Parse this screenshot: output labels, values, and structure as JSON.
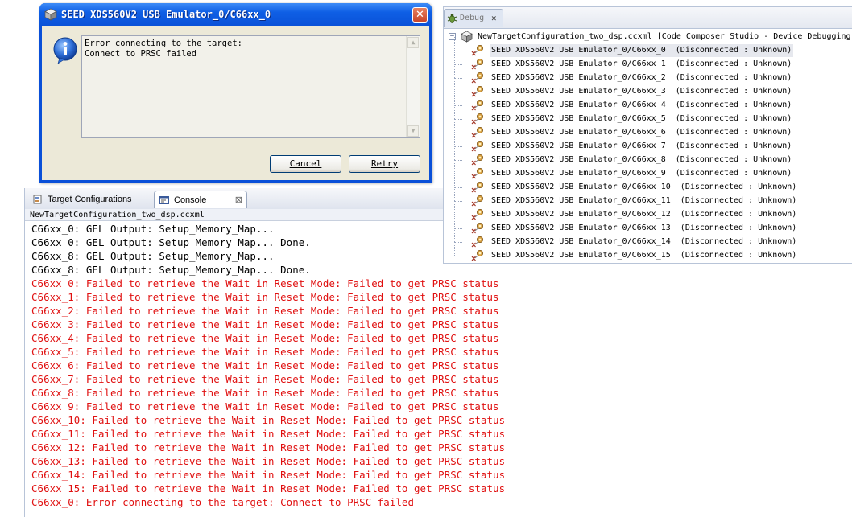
{
  "dialog": {
    "title": "SEED XDS560V2 USB Emulator_0/C66xx_0",
    "close_glyph": "✕",
    "message": "Error connecting to the target:\nConnect to PRSC failed",
    "cancel_label": "Cancel",
    "retry_label": "Retry",
    "icon": "info-icon"
  },
  "console_panel": {
    "tabs": [
      {
        "label": "Target Configurations",
        "icon": "target-config-icon"
      },
      {
        "label": "Console",
        "icon": "console-icon",
        "close": "⊠"
      }
    ],
    "path": "NewTargetConfiguration_two_dsp.ccxml",
    "lines": [
      {
        "text": "C66xx_0: GEL Output: Setup_Memory_Map...",
        "kind": "normal"
      },
      {
        "text": "C66xx_0: GEL Output: Setup_Memory_Map... Done.",
        "kind": "normal"
      },
      {
        "text": "C66xx_8: GEL Output: Setup_Memory_Map...",
        "kind": "normal"
      },
      {
        "text": "C66xx_8: GEL Output: Setup_Memory_Map... Done.",
        "kind": "normal"
      },
      {
        "text": "C66xx_0: Failed to retrieve the Wait in Reset Mode: Failed to get PRSC status",
        "kind": "error"
      },
      {
        "text": "C66xx_1: Failed to retrieve the Wait in Reset Mode: Failed to get PRSC status",
        "kind": "error"
      },
      {
        "text": "C66xx_2: Failed to retrieve the Wait in Reset Mode: Failed to get PRSC status",
        "kind": "error"
      },
      {
        "text": "C66xx_3: Failed to retrieve the Wait in Reset Mode: Failed to get PRSC status",
        "kind": "error"
      },
      {
        "text": "C66xx_4: Failed to retrieve the Wait in Reset Mode: Failed to get PRSC status",
        "kind": "error"
      },
      {
        "text": "C66xx_5: Failed to retrieve the Wait in Reset Mode: Failed to get PRSC status",
        "kind": "error"
      },
      {
        "text": "C66xx_6: Failed to retrieve the Wait in Reset Mode: Failed to get PRSC status",
        "kind": "error"
      },
      {
        "text": "C66xx_7: Failed to retrieve the Wait in Reset Mode: Failed to get PRSC status",
        "kind": "error"
      },
      {
        "text": "C66xx_8: Failed to retrieve the Wait in Reset Mode: Failed to get PRSC status",
        "kind": "error"
      },
      {
        "text": "C66xx_9: Failed to retrieve the Wait in Reset Mode: Failed to get PRSC status",
        "kind": "error"
      },
      {
        "text": "C66xx_10: Failed to retrieve the Wait in Reset Mode: Failed to get PRSC status",
        "kind": "error"
      },
      {
        "text": "C66xx_11: Failed to retrieve the Wait in Reset Mode: Failed to get PRSC status",
        "kind": "error"
      },
      {
        "text": "C66xx_12: Failed to retrieve the Wait in Reset Mode: Failed to get PRSC status",
        "kind": "error"
      },
      {
        "text": "C66xx_13: Failed to retrieve the Wait in Reset Mode: Failed to get PRSC status",
        "kind": "error"
      },
      {
        "text": "C66xx_14: Failed to retrieve the Wait in Reset Mode: Failed to get PRSC status",
        "kind": "error"
      },
      {
        "text": "C66xx_15: Failed to retrieve the Wait in Reset Mode: Failed to get PRSC status",
        "kind": "error"
      },
      {
        "text": "C66xx_0: Error connecting to the target: Connect to PRSC failed",
        "kind": "error"
      }
    ],
    "colors": {
      "normal": "#000000",
      "error": "#e01010"
    }
  },
  "debug_panel": {
    "tab_label": "Debug",
    "tab_icon": "debug-bug-icon",
    "tab_close": "✕",
    "root": {
      "toggle": "−",
      "label": "NewTargetConfiguration_two_dsp.ccxml [Code Composer Studio - Device Debugging]",
      "icon": "target-cube-icon"
    },
    "items": [
      {
        "label": "SEED XDS560V2 USB Emulator_0/C66xx_0  (Disconnected : Unknown)",
        "selected": true
      },
      {
        "label": "SEED XDS560V2 USB Emulator_0/C66xx_1  (Disconnected : Unknown)"
      },
      {
        "label": "SEED XDS560V2 USB Emulator_0/C66xx_2  (Disconnected : Unknown)"
      },
      {
        "label": "SEED XDS560V2 USB Emulator_0/C66xx_3  (Disconnected : Unknown)"
      },
      {
        "label": "SEED XDS560V2 USB Emulator_0/C66xx_4  (Disconnected : Unknown)"
      },
      {
        "label": "SEED XDS560V2 USB Emulator_0/C66xx_5  (Disconnected : Unknown)"
      },
      {
        "label": "SEED XDS560V2 USB Emulator_0/C66xx_6  (Disconnected : Unknown)"
      },
      {
        "label": "SEED XDS560V2 USB Emulator_0/C66xx_7  (Disconnected : Unknown)"
      },
      {
        "label": "SEED XDS560V2 USB Emulator_0/C66xx_8  (Disconnected : Unknown)"
      },
      {
        "label": "SEED XDS560V2 USB Emulator_0/C66xx_9  (Disconnected : Unknown)"
      },
      {
        "label": "SEED XDS560V2 USB Emulator_0/C66xx_10  (Disconnected : Unknown)"
      },
      {
        "label": "SEED XDS560V2 USB Emulator_0/C66xx_11  (Disconnected : Unknown)"
      },
      {
        "label": "SEED XDS560V2 USB Emulator_0/C66xx_12  (Disconnected : Unknown)"
      },
      {
        "label": "SEED XDS560V2 USB Emulator_0/C66xx_13  (Disconnected : Unknown)"
      },
      {
        "label": "SEED XDS560V2 USB Emulator_0/C66xx_14  (Disconnected : Unknown)"
      },
      {
        "label": "SEED XDS560V2 USB Emulator_0/C66xx_15  (Disconnected : Unknown)"
      }
    ]
  }
}
